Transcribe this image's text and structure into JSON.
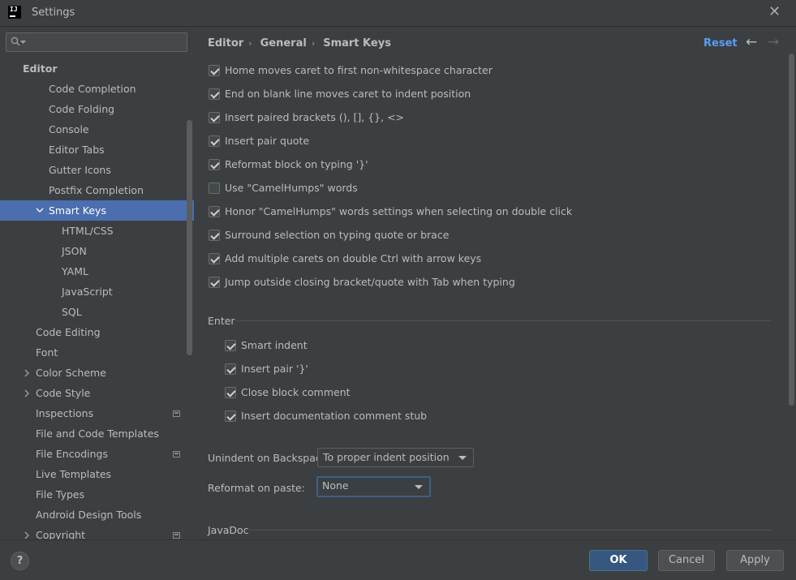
{
  "window": {
    "title": "Settings",
    "logo_text": "IJ",
    "close_glyph": "✕"
  },
  "search": {
    "placeholder": "",
    "icon": "search-icon"
  },
  "sidebar": {
    "items": [
      {
        "label": "Editor"
      },
      {
        "label": "Code Completion"
      },
      {
        "label": "Code Folding"
      },
      {
        "label": "Console"
      },
      {
        "label": "Editor Tabs"
      },
      {
        "label": "Gutter Icons"
      },
      {
        "label": "Postfix Completion"
      },
      {
        "label": "Smart Keys"
      },
      {
        "label": "HTML/CSS"
      },
      {
        "label": "JSON"
      },
      {
        "label": "YAML"
      },
      {
        "label": "JavaScript"
      },
      {
        "label": "SQL"
      },
      {
        "label": "Code Editing"
      },
      {
        "label": "Font"
      },
      {
        "label": "Color Scheme"
      },
      {
        "label": "Code Style"
      },
      {
        "label": "Inspections"
      },
      {
        "label": "File and Code Templates"
      },
      {
        "label": "File Encodings"
      },
      {
        "label": "Live Templates"
      },
      {
        "label": "File Types"
      },
      {
        "label": "Android Design Tools"
      },
      {
        "label": "Copyright"
      }
    ]
  },
  "breadcrumb": {
    "part1": "Editor",
    "part2": "General",
    "part3": "Smart Keys",
    "sep": "›"
  },
  "header": {
    "reset": "Reset",
    "back_glyph": "←",
    "forward_glyph": "→"
  },
  "options": [
    {
      "label": "Home moves caret to first non-whitespace character",
      "checked": true
    },
    {
      "label": "End on blank line moves caret to indent position",
      "checked": true
    },
    {
      "label": "Insert paired brackets (), [], {}, <>",
      "checked": true
    },
    {
      "label": "Insert pair quote",
      "checked": true
    },
    {
      "label": "Reformat block on typing '}'",
      "checked": true
    },
    {
      "label": "Use \"CamelHumps\" words",
      "checked": false
    },
    {
      "label": "Honor \"CamelHumps\" words settings when selecting on double click",
      "checked": true
    },
    {
      "label": "Surround selection on typing quote or brace",
      "checked": true
    },
    {
      "label": "Add multiple carets on double Ctrl with arrow keys",
      "checked": true
    },
    {
      "label": "Jump outside closing bracket/quote with Tab when typing",
      "checked": true
    }
  ],
  "enter": {
    "title": "Enter",
    "options": [
      {
        "label": "Smart indent",
        "checked": true
      },
      {
        "label": "Insert pair '}'",
        "checked": true
      },
      {
        "label": "Close block comment",
        "checked": true
      },
      {
        "label": "Insert documentation comment stub",
        "checked": true
      }
    ]
  },
  "unindent": {
    "label": "Unindent on Backspace:",
    "value": "To proper indent position"
  },
  "reformat": {
    "label": "Reformat on paste:",
    "value": "None"
  },
  "javadoc": {
    "title": "JavaDoc"
  },
  "footer": {
    "help": "?",
    "ok": "OK",
    "cancel": "Cancel",
    "apply": "Apply"
  }
}
